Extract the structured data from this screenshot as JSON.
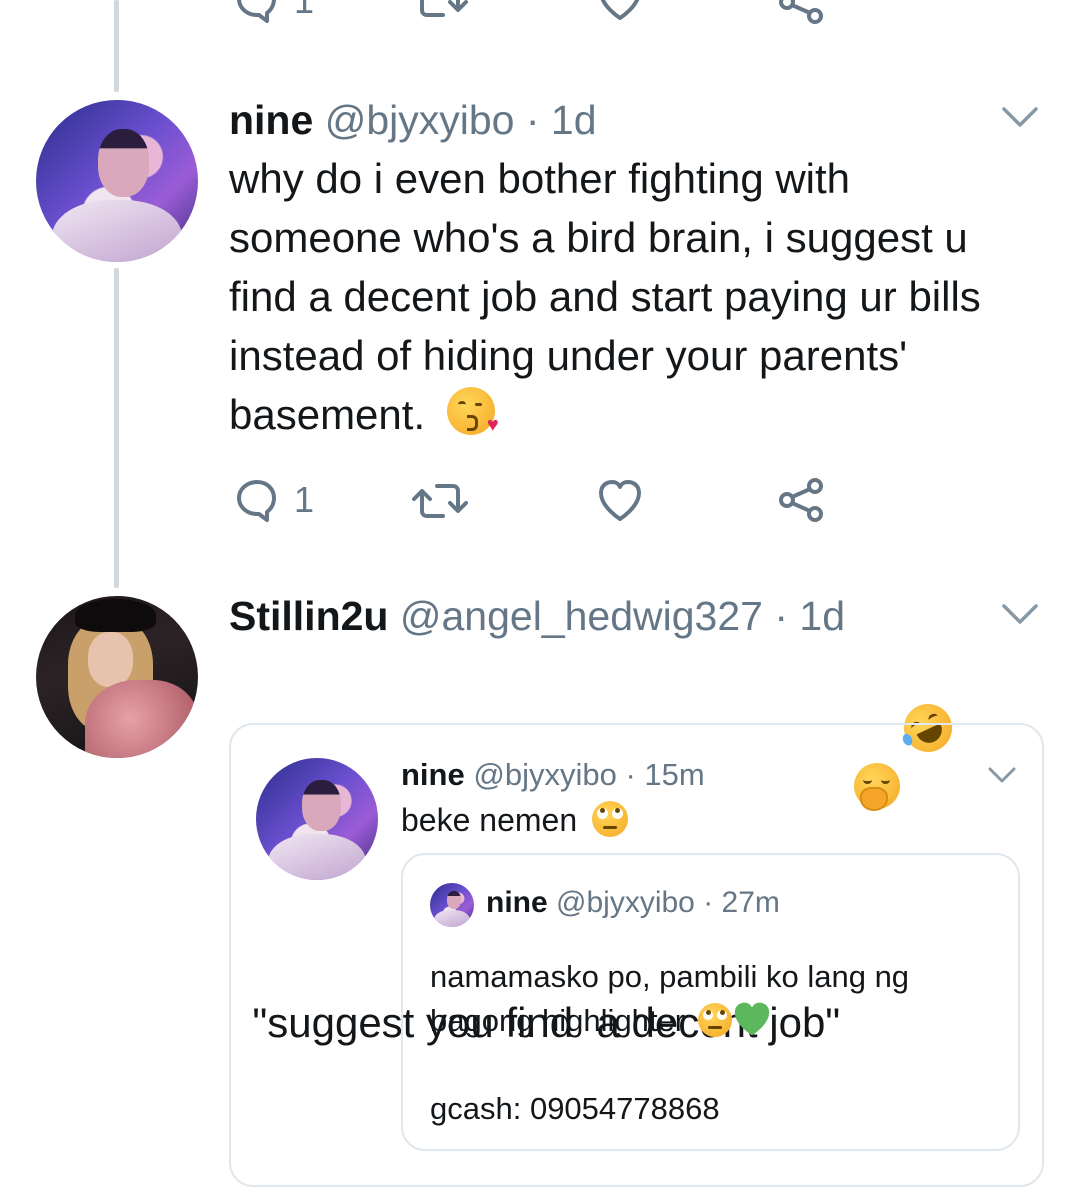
{
  "top_tweet": {
    "reply_count": "1"
  },
  "tweet1": {
    "name": "nine",
    "handle": "@bjyxyibo",
    "time": "1d",
    "text_lines": [
      "why do i even bother fighting with",
      "someone who's a bird brain, i suggest u",
      "find a decent job and start paying ur bills",
      "instead of hiding under your parents'",
      "basement."
    ],
    "emoji": "face-blowing-a-kiss",
    "reply_count": "1"
  },
  "tweet2": {
    "name": "Stillin2u",
    "handle": "@angel_hedwig327",
    "time": "1d",
    "text": "\"suggest you find  a decent job\"",
    "emojis": [
      "face-with-hand-over-mouth",
      "rolling-on-the-floor-laughing"
    ],
    "quote": {
      "name": "nine",
      "handle": "@bjyxyibo",
      "time": "15m",
      "text": "beke nemen",
      "emoji": "face-with-rolling-eyes",
      "nested_quote": {
        "name": "nine",
        "handle": "@bjyxyibo",
        "time": "27m",
        "line1": "namamasko po, pambili ko lang ng",
        "line2": "bagong highlighter",
        "emojis": [
          "face-with-rolling-eyes",
          "green-heart"
        ],
        "line3": "gcash: 09054778868"
      }
    }
  },
  "separator": "·",
  "colors": {
    "text": "#14171a",
    "muted": "#657786",
    "thread_line": "#cfd9de",
    "border": "#e1e8ed"
  }
}
